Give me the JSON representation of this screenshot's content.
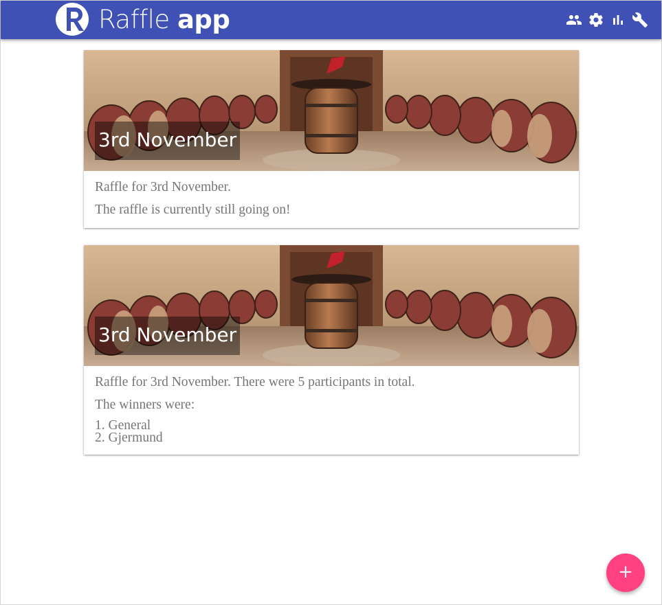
{
  "app": {
    "logo_light": "Raffle",
    "logo_bold": "app",
    "brand_color": "#3f51b5",
    "accent_color": "#ff4081"
  },
  "toolbar": {
    "actions": [
      {
        "icon": "people-icon"
      },
      {
        "icon": "settings-icon"
      },
      {
        "icon": "bar-chart-icon"
      },
      {
        "icon": "wrench-icon"
      }
    ]
  },
  "raffles": [
    {
      "title": "3rd November",
      "description": "Raffle for 3rd November.",
      "status": "The raffle is currently still going on!"
    },
    {
      "title": "3rd November",
      "description": "Raffle for 3rd November. There were 5 participants in total.",
      "winners_heading": "The winners were:",
      "winners": [
        "1. General",
        "2. Gjermund"
      ]
    }
  ],
  "fab": {
    "label": "+",
    "icon": "add-icon"
  }
}
